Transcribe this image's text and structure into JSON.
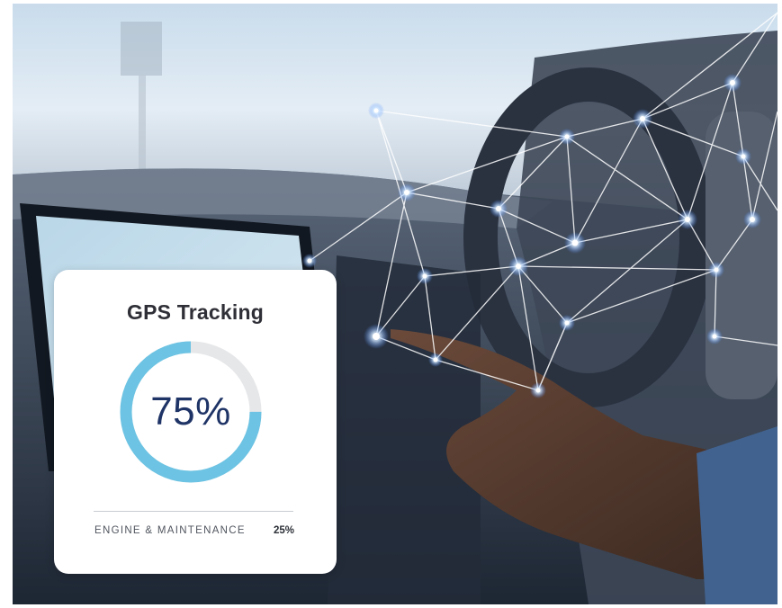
{
  "card": {
    "title": "GPS Tracking",
    "progress_value": 0.75,
    "progress_label": "75%",
    "stat_label": "ENGINE & MAINTENANCE",
    "stat_value": "25%"
  },
  "colors": {
    "progress_fill": "#6cc3e3",
    "progress_track": "#e6e7e9",
    "value_text": "#1f3466",
    "network_glow": "#ffffff"
  },
  "scene": {
    "subject": "hand-touching-car-dashboard-screen",
    "overlay": "network-node-icon"
  }
}
